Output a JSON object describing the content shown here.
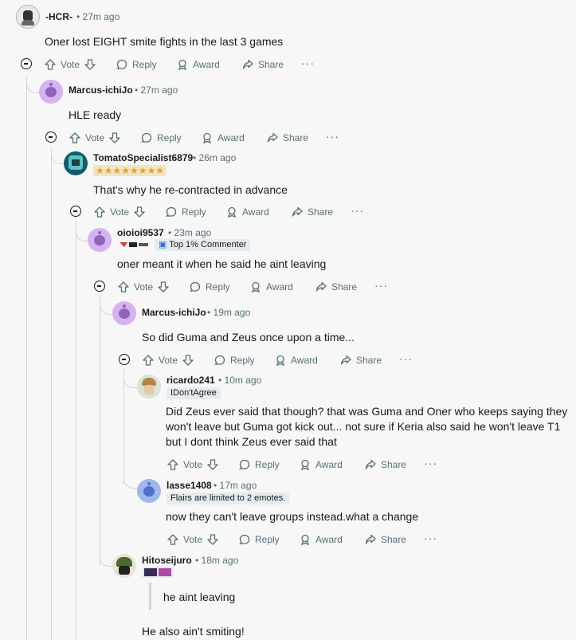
{
  "actions": {
    "vote": "Vote",
    "reply": "Reply",
    "award": "Award",
    "share": "Share",
    "more": "···"
  },
  "comments": [
    {
      "username": "-HCR-",
      "time": "27m ago",
      "body": "Oner lost EIGHT smite fights in the last 3 games",
      "avatar_icon": "sketch-avatar-icon"
    },
    {
      "username": "Marcus-ichiJo",
      "time": "27m ago",
      "body": "HLE ready",
      "avatar_icon": "snoo-avatar-icon"
    },
    {
      "username": "TomatoSpecialist6879",
      "time": "26m ago",
      "body": "That's why he re-contracted in advance",
      "flair": "★★★★★★★★",
      "avatar_icon": "pixel-avatar-icon"
    },
    {
      "username": "oioioi9537",
      "time": "23m ago",
      "body": "oner meant it when he said he aint leaving",
      "flair": "Top 1% Commenter",
      "avatar_icon": "snoo-avatar-icon"
    },
    {
      "username": "Marcus-ichiJo",
      "time": "19m ago",
      "body": "So did Guma and Zeus once upon a time...",
      "avatar_icon": "snoo-avatar-icon"
    },
    {
      "username": "ricardo241",
      "time": "10m ago",
      "body": "Did Zeus ever said that though? that was Guma and Oner who keeps saying they won't leave but Guma got kick out... not sure if Keria also said he won't leave T1 but I dont think Zeus ever said that",
      "flair": "IDon'tAgree",
      "avatar_icon": "character-avatar-icon"
    },
    {
      "username": "lasse1408",
      "time": "17m ago",
      "body": "now they can't leave groups instead.what a change",
      "flair": "Flairs are limited to 2 emotes.",
      "avatar_icon": "snoo-avatar-icon"
    },
    {
      "username": "Hitoseijuro",
      "time": "18m ago",
      "quote": "he aint leaving",
      "body": "He also ain't smiting!",
      "avatar_icon": "character-avatar-icon"
    }
  ],
  "colors": {
    "background": "#f7f7f7",
    "text": "#1a1a1b",
    "meta": "#576f76",
    "thread_line": "#d3d6d9",
    "flair_bg": "#e5ebee"
  }
}
